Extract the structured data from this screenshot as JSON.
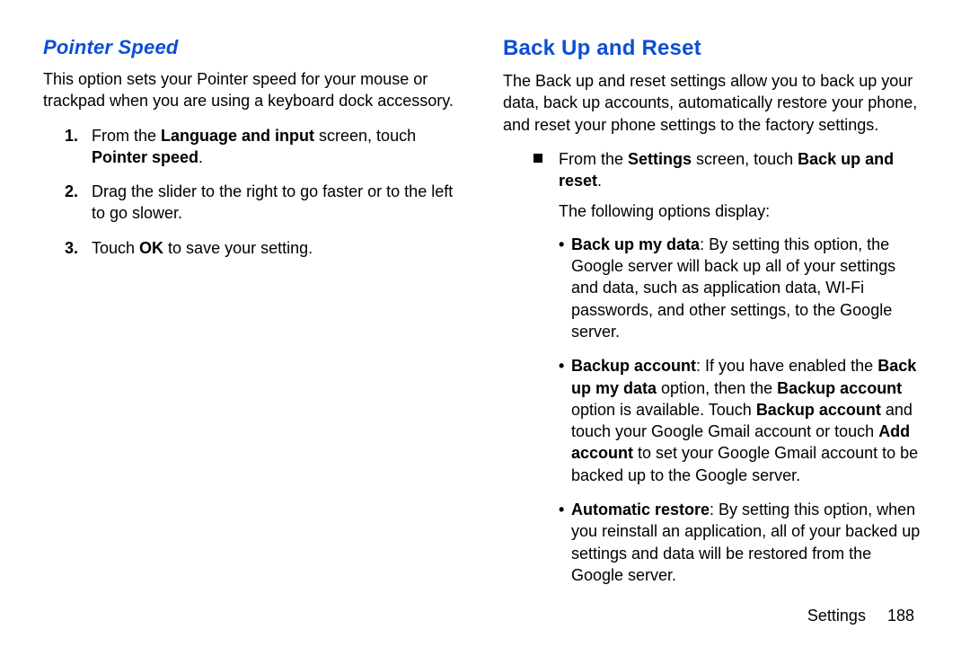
{
  "left": {
    "heading": "Pointer Speed",
    "intro": "This option sets your Pointer speed for your mouse or trackpad when you are using a keyboard dock accessory.",
    "steps": {
      "s1_prefix": "From the ",
      "s1_bold1": "Language and input",
      "s1_mid": " screen, touch ",
      "s1_bold2": "Pointer speed",
      "s1_suffix": ".",
      "s2": "Drag the slider to the right to go faster or to the left to go slower.",
      "s3_prefix": "Touch ",
      "s3_bold": "OK",
      "s3_suffix": " to save your setting."
    }
  },
  "right": {
    "heading": "Back Up and Reset",
    "intro": "The Back up and reset settings allow you to back up your data, back up accounts, automatically restore your phone, and reset your phone settings to the factory settings.",
    "from_line": {
      "prefix": "From the ",
      "b1": "Settings",
      "mid": " screen, touch ",
      "b2": "Back up and reset",
      "suffix": "."
    },
    "following": "The following options display:",
    "bullets": {
      "b1_label": "Back up my data",
      "b1_body": ": By setting this option, the Google server will back up all of your settings and data, such as application data, WI-Fi passwords, and other settings, to the Google server.",
      "b2_label": "Backup account",
      "b2_p1": ": If you have enabled the ",
      "b2_bold_a": "Back up my data",
      "b2_p2": " option, then the ",
      "b2_bold_b": "Backup account",
      "b2_p3": " option is available. Touch ",
      "b2_bold_c": "Backup account",
      "b2_p4": " and touch your Google Gmail account or touch ",
      "b2_bold_d": "Add account",
      "b2_p5": " to set your Google Gmail account to be backed up to the Google server.",
      "b3_label": "Automatic restore",
      "b3_body": ": By setting this option, when you reinstall an application, all of your backed up settings and data will be restored from the Google server."
    }
  },
  "footer": {
    "section": "Settings",
    "page": "188"
  }
}
